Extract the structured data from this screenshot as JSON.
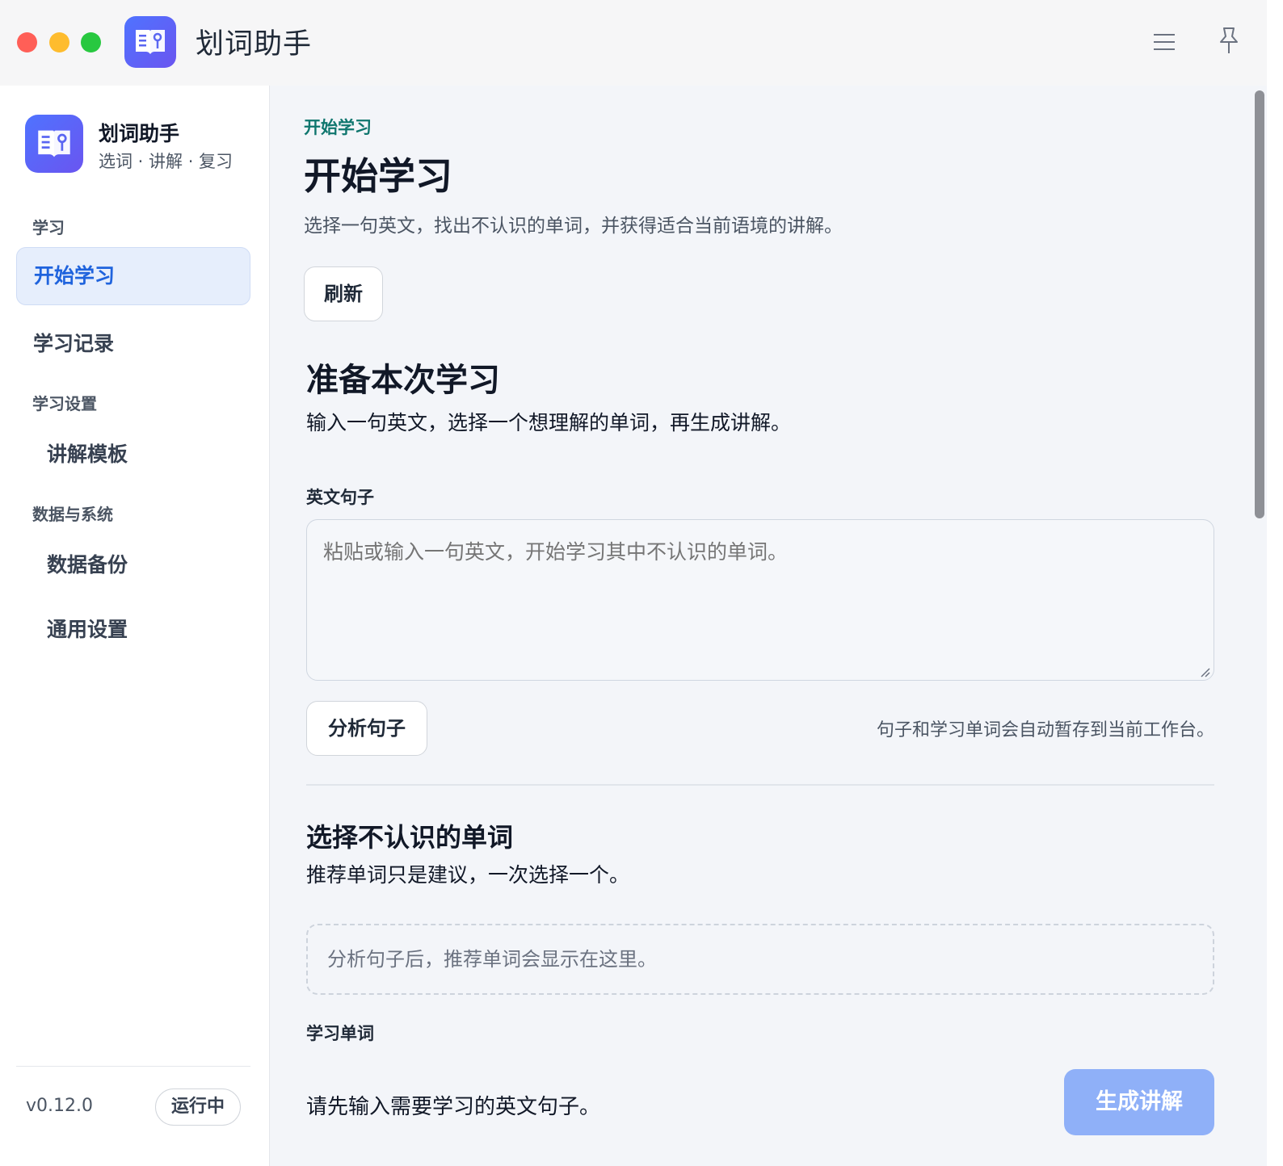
{
  "window": {
    "title": "划词助手"
  },
  "sidebar": {
    "brand_name": "划词助手",
    "brand_sub": "选词 · 讲解 · 复习",
    "groups": [
      {
        "label": "学习"
      },
      {
        "label": "学习设置"
      },
      {
        "label": "数据与系统"
      }
    ],
    "items": [
      {
        "label": "开始学习",
        "active": true
      },
      {
        "label": "学习记录"
      },
      {
        "label": "讲解模板"
      },
      {
        "label": "数据备份"
      },
      {
        "label": "通用设置"
      }
    ],
    "version": "v0.12.0",
    "status": "运行中"
  },
  "main": {
    "eyebrow": "开始学习",
    "title": "开始学习",
    "description": "选择一句英文，找出不认识的单词，并获得适合当前语境的讲解。",
    "refresh_label": "刷新",
    "prepare": {
      "title": "准备本次学习",
      "description": "输入一句英文，选择一个想理解的单词，再生成讲解。",
      "field_label": "英文句子",
      "placeholder": "粘贴或输入一句英文，开始学习其中不认识的单词。",
      "value": "",
      "analyze_label": "分析句子",
      "hint": "句子和学习单词会自动暂存到当前工作台。"
    },
    "select": {
      "title": "选择不认识的单词",
      "description": "推荐单词只是建议，一次选择一个。",
      "empty_text": "分析句子后，推荐单词会显示在这里。",
      "field_label": "学习单词"
    },
    "footer": {
      "message": "请先输入需要学习的英文句子。",
      "generate_label": "生成讲解"
    }
  },
  "colors": {
    "accent": "#1f63dd",
    "eyebrow": "#0f766e",
    "primary_disabled": "#8fb0f8"
  },
  "icons": {
    "app": "book-icon",
    "menu": "hamburger-icon",
    "pin": "pin-icon"
  }
}
